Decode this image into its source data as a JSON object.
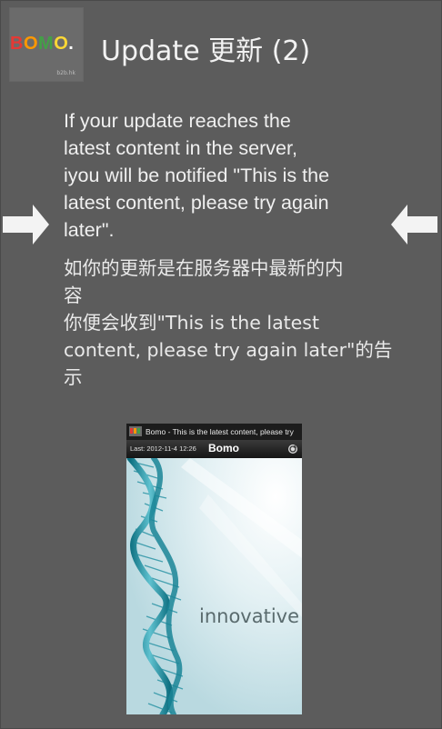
{
  "header": {
    "logo_text": "BOMO.",
    "logo_subtext": "b2b.hk",
    "title": "Update 更新 (2)"
  },
  "description_en": [
    "If your update reaches the",
    "latest content in the server,",
    "iyou will be notified \"This is the",
    "latest content, please try again",
    "later\"."
  ],
  "description_zh": [
    "如你的更新是在服务器中最新的内",
    "容",
    "你便会收到\"This is the latest",
    "content, please try again later\"的告",
    "示"
  ],
  "navigation": {
    "prev_icon": "arrow-right-icon",
    "next_icon": "arrow-left-icon"
  },
  "screenshot": {
    "notification_text": "Bomo - This is the latest content, please try",
    "last_updated": "Last:  2012-11-4  12:26",
    "app_title": "Bomo",
    "image_caption": "innovative"
  },
  "colors": {
    "background": "#5c5c5c",
    "text": "#f0f0f0",
    "logo_b": "#e53935",
    "logo_o1": "#ff9800",
    "logo_m": "#43a047",
    "logo_o2": "#fdd835",
    "logo_dot": "#ffffff"
  }
}
